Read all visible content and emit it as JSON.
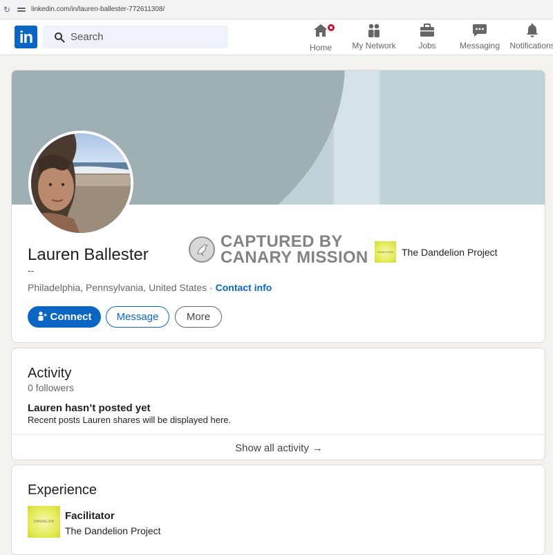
{
  "browser": {
    "url": "linkedin.com/in/lauren-ballester-772611308/"
  },
  "nav": {
    "logo_text": "in",
    "search_placeholder": "Search",
    "items": [
      {
        "label": "Home",
        "icon": "home-icon"
      },
      {
        "label": "My Network",
        "icon": "network-icon"
      },
      {
        "label": "Jobs",
        "icon": "briefcase-icon"
      },
      {
        "label": "Messaging",
        "icon": "messaging-icon"
      },
      {
        "label": "Notifications",
        "icon": "bell-icon"
      }
    ]
  },
  "profile": {
    "name": "Lauren Ballester",
    "headline": "--",
    "location": "Philadelphia, Pennsylvania, United States",
    "separator": " · ",
    "contact_info": "Contact info",
    "organization": "The Dandelion Project",
    "buttons": {
      "connect": "Connect",
      "message": "Message",
      "more": "More"
    },
    "watermark": {
      "line1": "CAPTURED BY",
      "line2": "CANARY MISSION"
    }
  },
  "activity": {
    "title": "Activity",
    "followers": "0 followers",
    "empty_title": "Lauren hasn’t posted yet",
    "empty_subtitle": "Recent posts Lauren shares will be displayed here.",
    "show_all": "Show all activity",
    "arrow": "→"
  },
  "experience": {
    "title": "Experience",
    "items": [
      {
        "role": "Facilitator",
        "company": "The Dandelion Project"
      }
    ]
  },
  "colors": {
    "brand_blue": "#0a66c2",
    "page_bg": "#f4f2ee",
    "banner": "#bed2d7",
    "notification_badge": "#cb112d"
  }
}
